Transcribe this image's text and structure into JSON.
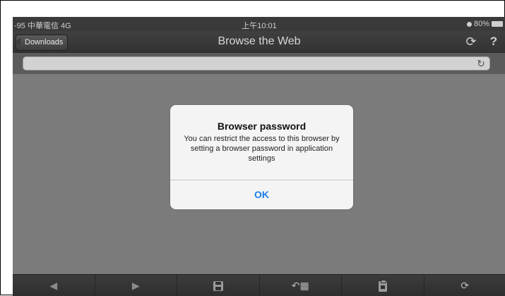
{
  "status_bar": {
    "carrier": "-95 中華電信 4G",
    "time": "上午10:01",
    "battery": "80%"
  },
  "nav": {
    "back_label": "Downloads",
    "title": "Browse the Web",
    "help_label": "?"
  },
  "url_bar": {
    "value": "",
    "placeholder": ""
  },
  "alert": {
    "title": "Browser password",
    "message": "You can restrict the access to this browser by setting a browser password in application settings",
    "ok_label": "OK"
  },
  "toolbar": {
    "items": [
      "back-arrow",
      "forward-arrow",
      "save-disk",
      "share-bookmark",
      "clipboard",
      "reload"
    ]
  },
  "colors": {
    "accent": "#1a7ee8",
    "content_bg": "#7b7b7b",
    "bar_bg": "#333333"
  }
}
